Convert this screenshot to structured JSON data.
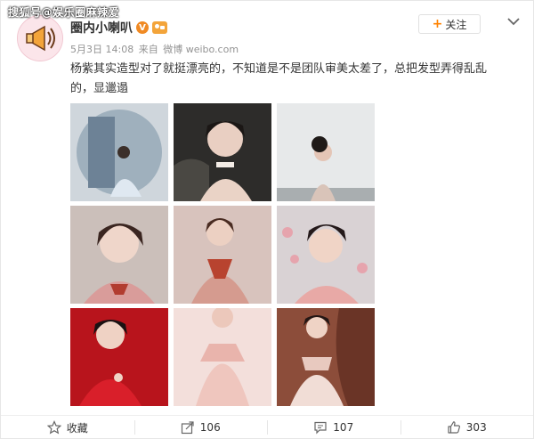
{
  "watermark": "搜狐号@娱乐圈麻辣爱",
  "post": {
    "username": "圈内小喇叭",
    "verified_mark": "V",
    "date": "5月3日 14:08",
    "source_prefix": "来自",
    "source": "微博 weibo.com",
    "text": "杨紫其实造型对了就挺漂亮的，不知道是不是团队审美太差了，总把发型弄得乱乱的，显邋遢",
    "follow_label": "关注"
  },
  "images": [
    {
      "name": "photo-1",
      "bg": "#b9c5cf"
    },
    {
      "name": "photo-2",
      "bg": "#3a3a38"
    },
    {
      "name": "photo-3",
      "bg": "#e7e9ea"
    },
    {
      "name": "photo-4",
      "bg": "#c9bdb8"
    },
    {
      "name": "photo-5",
      "bg": "#d8c3bd"
    },
    {
      "name": "photo-6",
      "bg": "#e0b9bf"
    },
    {
      "name": "photo-7",
      "bg": "#b8141c"
    },
    {
      "name": "photo-8",
      "bg": "#f0d6d2"
    },
    {
      "name": "photo-9",
      "bg": "#8a4a38"
    }
  ],
  "actions": {
    "favorite_label": "收藏",
    "repost_count": "106",
    "comment_count": "107",
    "like_count": "303"
  },
  "colors": {
    "accent": "#ff8200",
    "meta": "#939393"
  }
}
